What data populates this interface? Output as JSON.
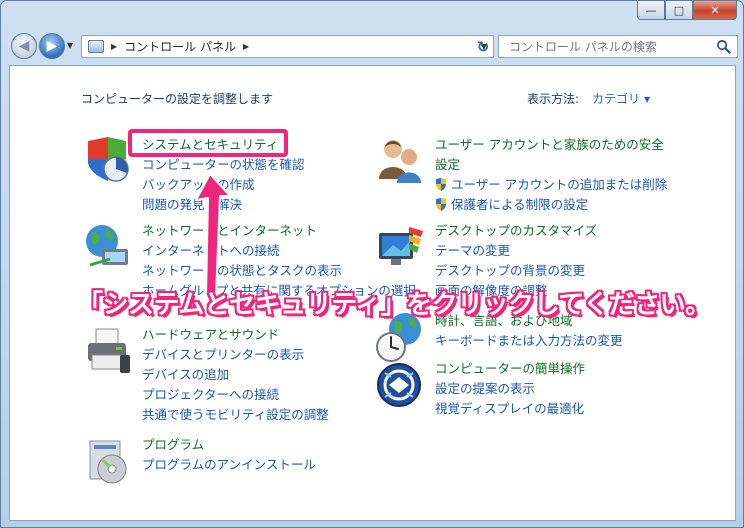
{
  "window": {
    "minimize_glyph": "—",
    "maximize_glyph": "□",
    "close_glyph": "✕"
  },
  "address": {
    "path": "コントロール パネル"
  },
  "search": {
    "placeholder": "コントロール パネルの検索"
  },
  "page": {
    "heading": "コンピューターの設定を調整します",
    "view_by_label": "表示方法:",
    "view_by_value": "カテゴリ"
  },
  "categories": [
    {
      "title": "システムとセキュリティ",
      "icon": "security-shield-icon",
      "links": [
        "コンピューターの状態を確認",
        "バックアップの作成",
        "問題の発見と解決"
      ]
    },
    {
      "title": "ネットワークとインターネット",
      "icon": "network-globe-icon",
      "links": [
        "インターネットへの接続",
        "ネットワークの状態とタスクの表示",
        "ホームグループと共有に関するオプションの選択"
      ]
    },
    {
      "title": "ハードウェアとサウンド",
      "icon": "printer-icon",
      "links": [
        "デバイスとプリンターの表示",
        "デバイスの追加",
        "プロジェクターへの接続",
        "共通で使うモビリティ設定の調整"
      ]
    },
    {
      "title": "プログラム",
      "icon": "programs-icon",
      "links": [
        "プログラムのアンインストール"
      ]
    },
    {
      "title_line1": "ユーザー アカウントと家族のための安全",
      "title_line2": "設定",
      "icon": "users-icon",
      "links": [
        "ユーザー アカウントの追加または削除",
        "保護者による制限の設定"
      ]
    },
    {
      "title": "デスクトップのカスタマイズ",
      "icon": "display-icon",
      "links": [
        "テーマの変更",
        "デスクトップの背景の変更",
        "画面の解像度の調整"
      ]
    },
    {
      "title": "時計、言語、および地域",
      "icon": "clock-globe-icon",
      "links": [
        "キーボードまたは入力方法の変更"
      ]
    },
    {
      "title": "コンピューターの簡単操作",
      "icon": "ease-of-access-icon",
      "links": [
        "設定の提案の表示",
        "視覚ディスプレイの最適化"
      ]
    }
  ],
  "annotation": {
    "callout_text": "「システムとセキュリティ」をクリックしてください。",
    "highlight_color": "#f0257c"
  }
}
